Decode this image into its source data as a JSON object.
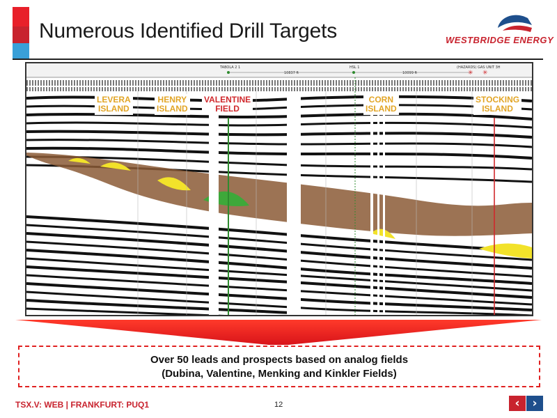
{
  "slide": {
    "title": "Numerous Identified Drill Targets",
    "logo_text": "WESTBRIDGE ENERGY",
    "page_number": "12"
  },
  "seismic": {
    "header_left_well": "TABOLA 2 1",
    "header_left_dist": "10837 ft",
    "header_right_well": "HSL 1",
    "header_right_dist": "10099 ft",
    "header_far_right": "(HAZARDS) GAS UNIT 3H",
    "labels": [
      {
        "line1": "LEVERA",
        "line2": "ISLAND",
        "color": "#e2a526"
      },
      {
        "line1": "HENRY",
        "line2": "ISLAND",
        "color": "#e2a526"
      },
      {
        "line1": "VALENTINE",
        "line2": "FIELD",
        "color": "#d0282c"
      },
      {
        "line1": "CORN",
        "line2": "ISLAND",
        "color": "#e2a526"
      },
      {
        "line1": "STOCKING",
        "line2": "ISLAND",
        "color": "#e2a526"
      }
    ],
    "colors": {
      "reservoir": "#8b5a36",
      "lead": "#f2e22a",
      "field": "#3ea83a",
      "well_red": "#d0282c",
      "well_green": "#2e8b2e"
    }
  },
  "callout": {
    "line1": "Over 50 leads and prospects based on analog fields",
    "line2": "(Dubina, Valentine, Menking and Kinkler Fields)"
  },
  "footer": {
    "ticker": "TSX.V: WEB | FRANKFURT: PUQ1",
    "prev_icon": "chevron-left-icon",
    "next_icon": "chevron-right-icon"
  },
  "theme": {
    "accent_red": "#c8232e",
    "accent_blue": "#3aa0d8",
    "nav_blue": "#1e4f8c"
  }
}
